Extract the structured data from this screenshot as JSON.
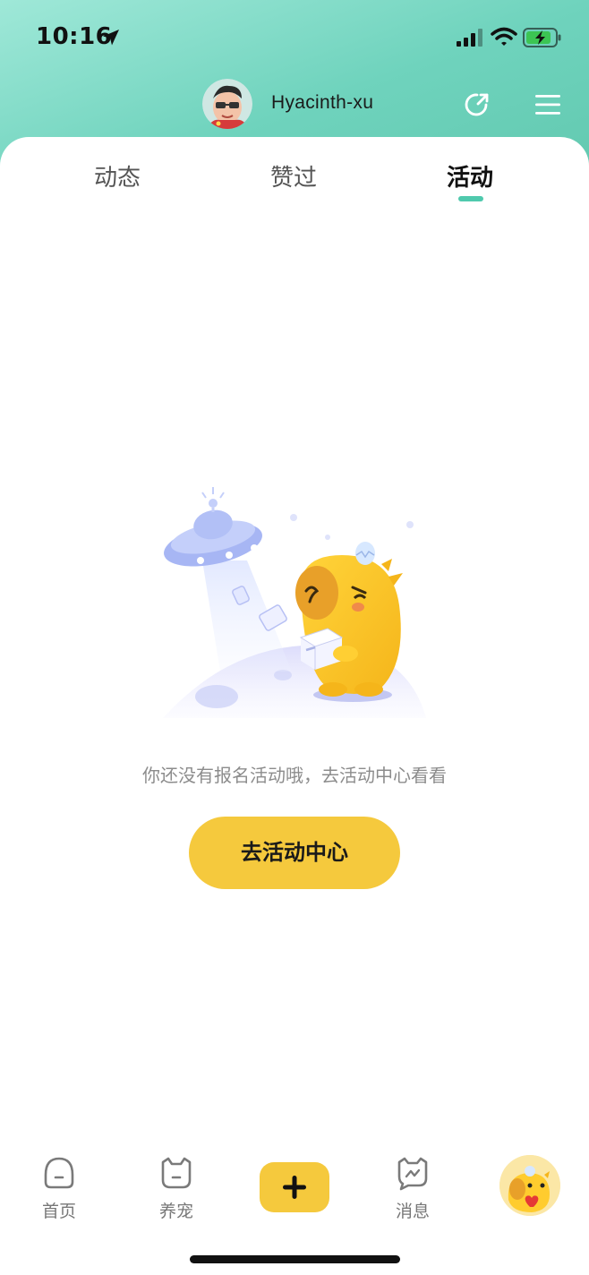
{
  "status_bar": {
    "time": "10:16"
  },
  "header": {
    "username": "Hyacinth-xu"
  },
  "tabs": [
    {
      "label": "动态",
      "active": false
    },
    {
      "label": "赞过",
      "active": false
    },
    {
      "label": "活动",
      "active": true
    }
  ],
  "empty_state": {
    "message": "你还没有报名活动哦，去活动中心看看",
    "button_label": "去活动中心"
  },
  "bottom_nav": {
    "items": [
      {
        "label": "首页",
        "icon": "home-face-icon"
      },
      {
        "label": "养宠",
        "icon": "cat-face-icon"
      },
      {
        "label": "",
        "icon": "plus-icon"
      },
      {
        "label": "消息",
        "icon": "message-cat-icon"
      },
      {
        "label": "",
        "icon": "profile-mascot-avatar"
      }
    ]
  },
  "colors": {
    "header_gradient_start": "#9fe8d8",
    "header_gradient_end": "#62c9b0",
    "accent_green": "#4fc9ad",
    "button_yellow": "#f5c93d"
  }
}
